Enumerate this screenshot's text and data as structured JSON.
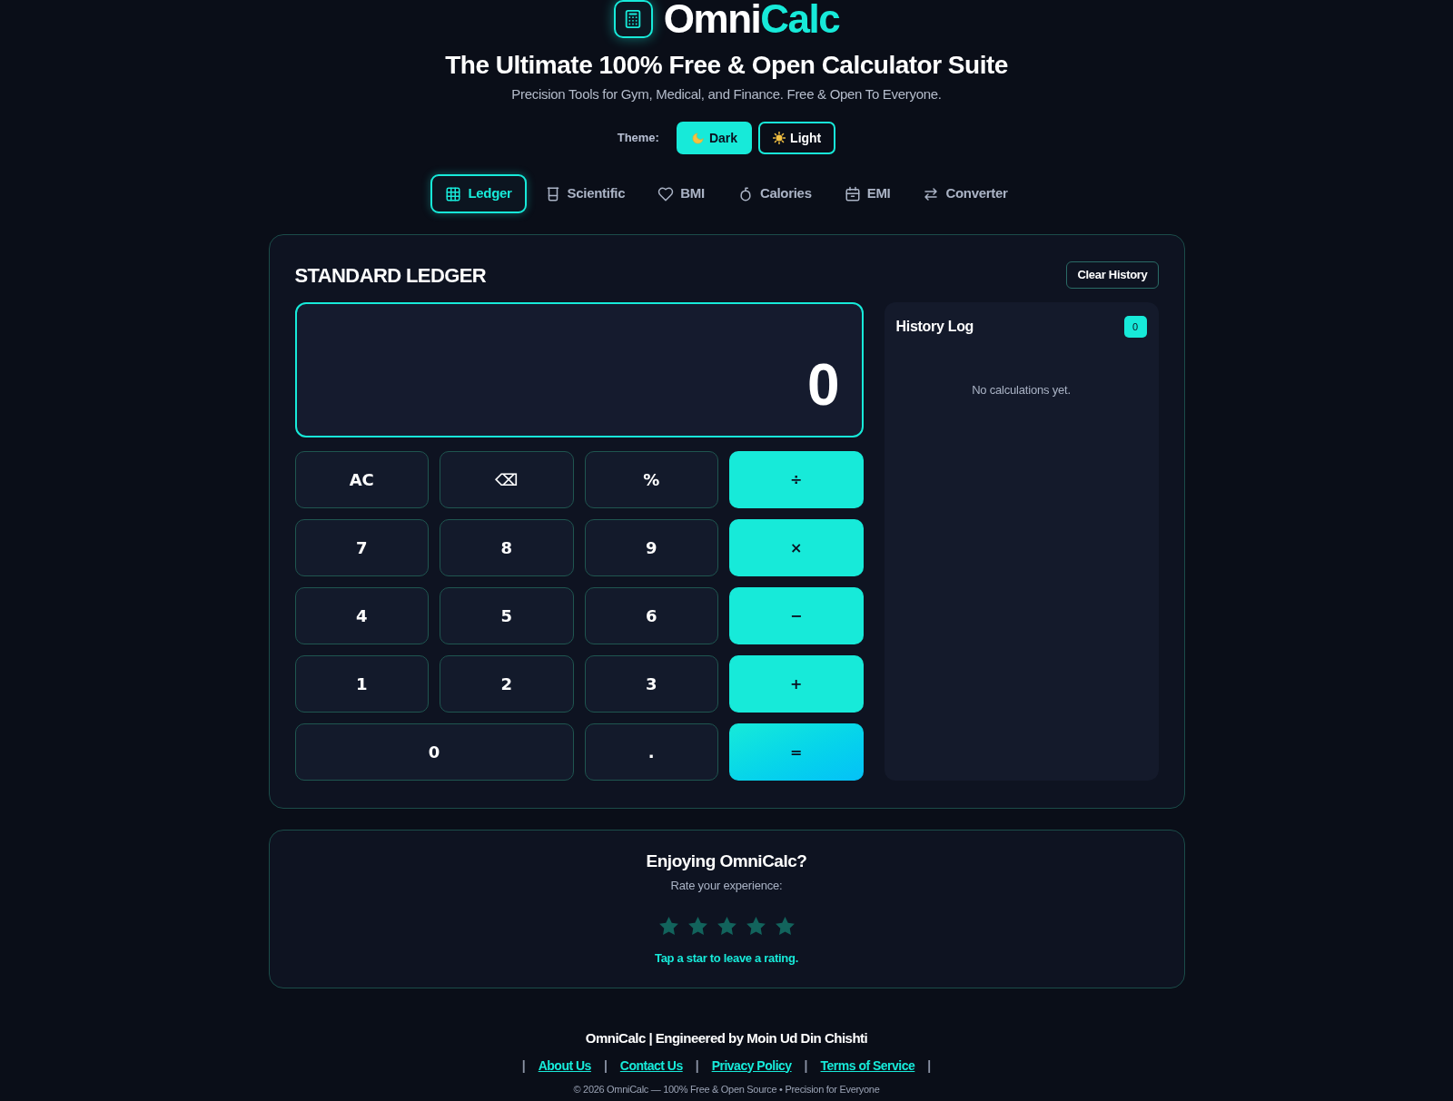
{
  "brand": {
    "lead": "Omni",
    "accent": "Calc"
  },
  "header": {
    "title": "The Ultimate 100% Free & Open Calculator Suite",
    "subtitle": "Precision Tools for Gym, Medical, and Finance. Free & Open To Everyone."
  },
  "theme": {
    "label": "Theme:",
    "options": [
      {
        "label": "Dark",
        "selected": true
      },
      {
        "label": "Light",
        "selected": false
      }
    ]
  },
  "tabs": [
    {
      "label": "Ledger",
      "selected": true
    },
    {
      "label": "Scientific",
      "selected": false
    },
    {
      "label": "BMI",
      "selected": false
    },
    {
      "label": "Calories",
      "selected": false
    },
    {
      "label": "EMI",
      "selected": false
    },
    {
      "label": "Converter",
      "selected": false
    }
  ],
  "ledger": {
    "title": "STANDARD LEDGER",
    "clear_button": "Clear History",
    "display": "0",
    "keys": [
      {
        "label": "AC",
        "kind": "function",
        "wide": false
      },
      {
        "label": "⌫",
        "kind": "function",
        "wide": false
      },
      {
        "label": "%",
        "kind": "function",
        "wide": false
      },
      {
        "label": "÷",
        "kind": "operator",
        "wide": false
      },
      {
        "label": "7",
        "kind": "digit",
        "wide": false
      },
      {
        "label": "8",
        "kind": "digit",
        "wide": false
      },
      {
        "label": "9",
        "kind": "digit",
        "wide": false
      },
      {
        "label": "×",
        "kind": "operator",
        "wide": false
      },
      {
        "label": "4",
        "kind": "digit",
        "wide": false
      },
      {
        "label": "5",
        "kind": "digit",
        "wide": false
      },
      {
        "label": "6",
        "kind": "digit",
        "wide": false
      },
      {
        "label": "−",
        "kind": "operator",
        "wide": false
      },
      {
        "label": "1",
        "kind": "digit",
        "wide": false
      },
      {
        "label": "2",
        "kind": "digit",
        "wide": false
      },
      {
        "label": "3",
        "kind": "digit",
        "wide": false
      },
      {
        "label": "+",
        "kind": "operator",
        "wide": false
      },
      {
        "label": "0",
        "kind": "digit",
        "wide": true
      },
      {
        "label": ".",
        "kind": "decimal",
        "wide": false
      },
      {
        "label": "=",
        "kind": "equals",
        "wide": false
      }
    ],
    "history": {
      "title": "History Log",
      "count": "0",
      "empty_text": "No calculations yet."
    }
  },
  "rating": {
    "title": "Enjoying OmniCalc?",
    "prompt": "Rate your experience:",
    "hint": "Tap a star to leave a rating."
  },
  "footer": {
    "credit": "OmniCalc | Engineered by Moin Ud Din Chishti",
    "separators": [
      "|",
      "|",
      "|",
      "|",
      "|"
    ],
    "links": [
      {
        "label": "About Us"
      },
      {
        "label": "Contact Us"
      },
      {
        "label": "Privacy Policy"
      },
      {
        "label": "Terms of Service"
      }
    ],
    "copyright": "© 2026 OmniCalc — 100% Free & Open Source • Precision for Everyone"
  }
}
